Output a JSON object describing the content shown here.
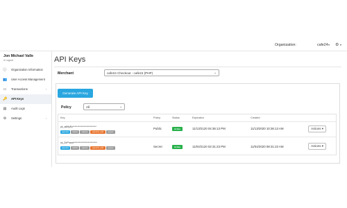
{
  "topbar": {
    "org_label": "Organization:",
    "org_value": "cafe24",
    "org_caret": "▾",
    "gear_icon": "gear-icon",
    "gear_glyph": "⚙",
    "gear_caret": "▾"
  },
  "sidebar": {
    "user_name": "Jon Michael Valle",
    "user_status": "● Logout",
    "items": [
      {
        "label": "Organization Information",
        "icon": "info-icon",
        "glyph": "ⓘ",
        "chevron": ""
      },
      {
        "label": "User Access Management",
        "icon": "users-icon",
        "glyph": "👥",
        "chevron": ""
      },
      {
        "label": "Transactions",
        "icon": "transactions-icon",
        "glyph": "▭",
        "chevron": "›"
      },
      {
        "label": "API Keys",
        "icon": "key-icon",
        "glyph": "🔑",
        "chevron": ""
      },
      {
        "label": "Audit Logs",
        "icon": "audit-icon",
        "glyph": "▤",
        "chevron": ""
      },
      {
        "label": "Settings",
        "icon": "settings-icon",
        "glyph": "⚙",
        "chevron": "›"
      }
    ]
  },
  "main": {
    "title": "API Keys",
    "merchant_label": "Merchant",
    "merchant_value": "cafe24 Checkout - cafe24 (PHP)",
    "generate_label": "Generate API Key",
    "policy_label": "Policy",
    "policy_value": "All",
    "select_caret": "⌄"
  },
  "table": {
    "headers": [
      "Key",
      "Policy",
      "Status",
      "Expiration",
      "Created"
    ],
    "rows": [
      {
        "key": "pk_a6f9yRz**************************",
        "perms": [
          "payment",
          "refund",
          "capture",
          "payment_void",
          "payout"
        ],
        "policy": "Public",
        "status": "Active",
        "expiration": "11/13/2120 04:36:13 PM",
        "created": "11/13/2020 10:36:13 AM",
        "actions": "Actions ▾"
      },
      {
        "key": "sk_2hP*seet**************************",
        "perms": [
          "payment",
          "refund",
          "capture",
          "payment_void",
          "payout"
        ],
        "policy": "Secret",
        "status": "Active",
        "expiration": "11/04/2120 02:31:23 PM",
        "created": "11/04/2020 08:31:23 AM",
        "actions": "Actions ▾"
      }
    ]
  },
  "colors": {
    "primary": "#2aa7e0",
    "active_green": "#27b04a",
    "perm_payment": "#2aa7e0",
    "perm_grey": "#9a9a9a",
    "perm_void": "#e8742e"
  }
}
